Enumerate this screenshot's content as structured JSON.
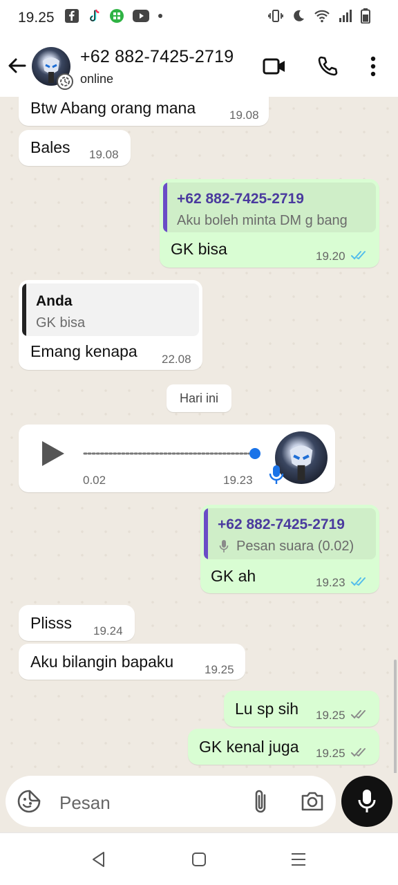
{
  "status_bar": {
    "time": "19.25",
    "left_icons": [
      "facebook-icon",
      "tiktok-icon",
      "app-icon",
      "youtube-icon",
      "dot-icon"
    ],
    "right_icons": [
      "vibrate-icon",
      "moon-icon",
      "wifi-icon",
      "signal-icon",
      "battery-icon"
    ]
  },
  "header": {
    "contact_name": "+62 882-7425-2719",
    "status": "online"
  },
  "messages": {
    "m1": {
      "text": "Btw Abang orang mana",
      "time": "19.08"
    },
    "m2": {
      "text": "Bales",
      "time": "19.08"
    },
    "m3": {
      "quote_name": "+62 882-7425-2719",
      "quote_text": "Aku boleh minta DM g bang",
      "text": "GK bisa",
      "time": "19.20",
      "ticks": "read"
    },
    "m4": {
      "quote_name": "Anda",
      "quote_text": "GK bisa",
      "text": "Emang kenapa",
      "time": "22.08"
    },
    "date_divider": "Hari ini",
    "m5": {
      "duration": "0.02",
      "time": "19.23"
    },
    "m6": {
      "quote_name": "+62 882-7425-2719",
      "quote_text": "Pesan suara (0.02)",
      "text": "GK ah",
      "time": "19.23",
      "ticks": "read"
    },
    "m7": {
      "text": "Plisss",
      "time": "19.24"
    },
    "m8": {
      "text": "Aku bilangin bapaku",
      "time": "19.25"
    },
    "m9": {
      "text": "Lu sp sih",
      "time": "19.25",
      "ticks": "delivered"
    },
    "m10": {
      "text": "GK kenal juga",
      "time": "19.25",
      "ticks": "delivered"
    }
  },
  "input": {
    "placeholder": "Pesan"
  },
  "colors": {
    "chat_bg": "#efeae2",
    "outgoing": "#d9fdd3",
    "incoming": "#ffffff",
    "quote_bar_out": "#6a4dc6",
    "quote_name_out": "#4a3a9e",
    "read_tick": "#53bdeb",
    "voice_dot": "#1a73e8"
  }
}
